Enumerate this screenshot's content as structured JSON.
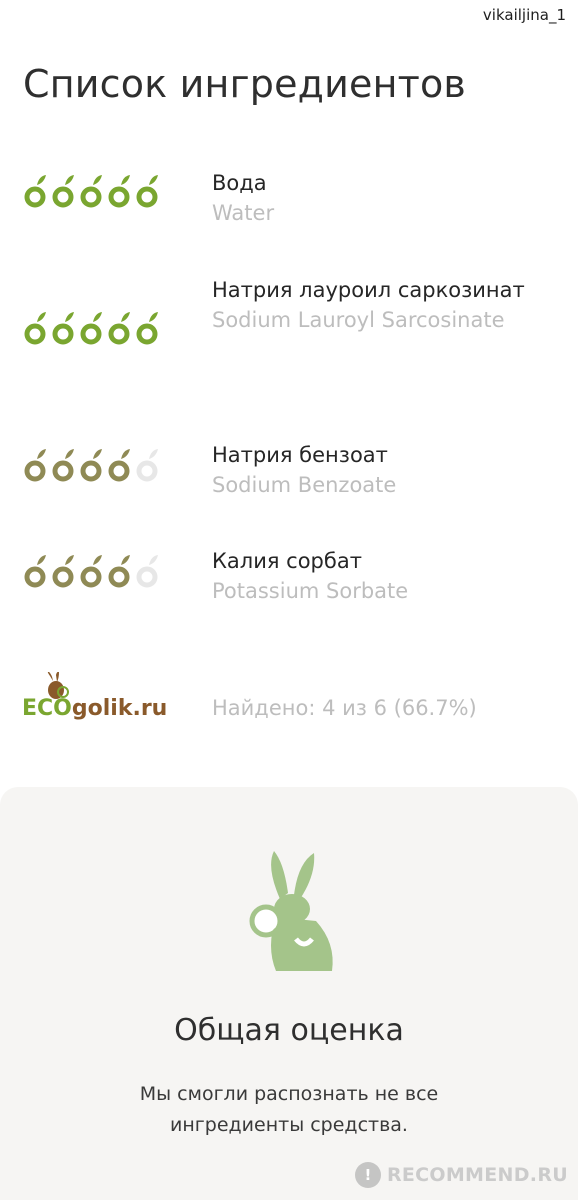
{
  "header": {
    "username": "vikailjina_1",
    "title": "Список ингредиентов"
  },
  "ingredients": [
    {
      "name_ru": "Вода",
      "name_en": "Water",
      "rating": 5,
      "rating_color": "#7aa630"
    },
    {
      "name_ru": "Натрия лауроил саркозинат",
      "name_en": "Sodium Lauroyl Sarcosinate",
      "rating": 5,
      "rating_color": "#7aa630"
    },
    {
      "name_ru": "Натрия бензоат",
      "name_en": "Sodium Benzoate",
      "rating": 4,
      "rating_color": "#8f8a55"
    },
    {
      "name_ru": "Калия сорбат",
      "name_en": "Potassium Sorbate",
      "rating": 4,
      "rating_color": "#8f8a55"
    }
  ],
  "footer_source": {
    "logo_text_part1": "ECO",
    "logo_text_part2": "golik.ru",
    "found_text": "Найдено: 4 из 6 (66.7%)"
  },
  "summary": {
    "title": "Общая оценка",
    "text": "Мы смогли распознать не все ингредиенты средства.",
    "icon": "rabbit-magnifier-icon",
    "icon_color": "#a4c48a"
  },
  "watermark": {
    "text": "RECOMMEND.RU"
  }
}
